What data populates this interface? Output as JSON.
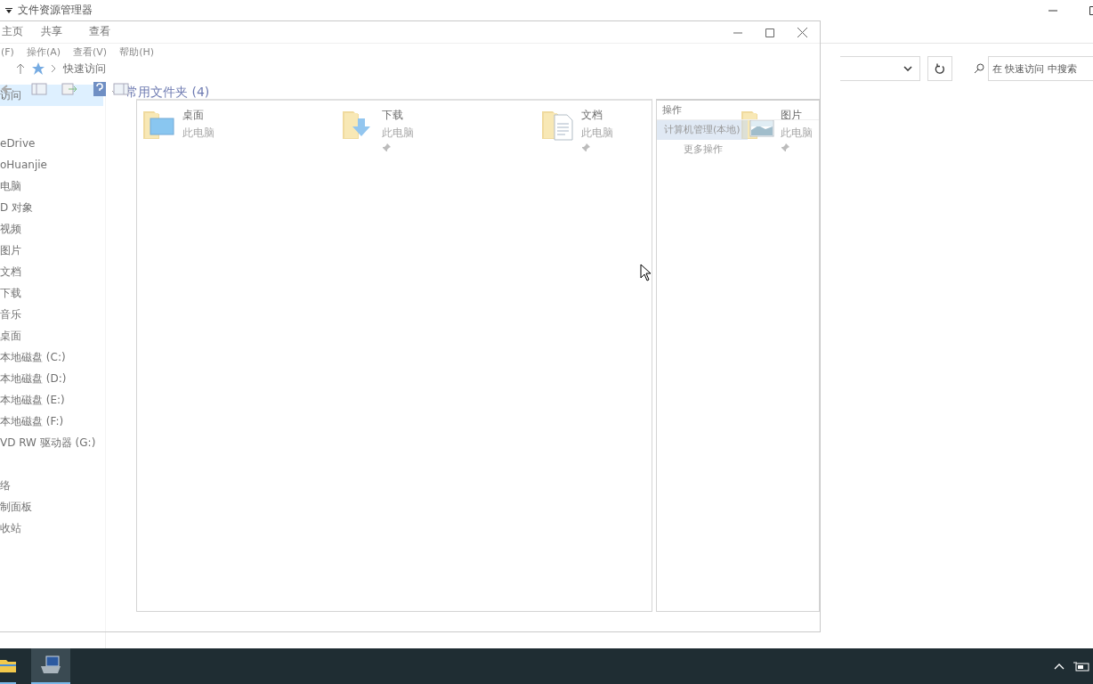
{
  "explorer": {
    "title": "文件资源管理器",
    "ribbon_tabs": [
      {
        "label": "主页",
        "selected": false
      },
      {
        "label": "共享",
        "selected": false
      },
      {
        "label": "查看",
        "selected": false
      }
    ],
    "address": {
      "location": "快速访问"
    },
    "search": {
      "placeholder": "在 快速访问 中搜索"
    },
    "nav_groups": [
      [
        {
          "label": "访问",
          "selected": true
        }
      ],
      [
        {
          "label": "eDrive",
          "selected": false
        },
        {
          "label": "oHuanjie",
          "selected": false
        },
        {
          "label": "电脑",
          "selected": false
        },
        {
          "label": "D 对象",
          "selected": false
        },
        {
          "label": "视频",
          "selected": false
        },
        {
          "label": "图片",
          "selected": false
        },
        {
          "label": "文档",
          "selected": false
        },
        {
          "label": "下载",
          "selected": false
        },
        {
          "label": "音乐",
          "selected": false
        },
        {
          "label": "桌面",
          "selected": false
        },
        {
          "label": "本地磁盘 (C:)",
          "selected": false
        },
        {
          "label": "本地磁盘 (D:)",
          "selected": false
        },
        {
          "label": "本地磁盘 (E:)",
          "selected": false
        },
        {
          "label": "本地磁盘 (F:)",
          "selected": false
        },
        {
          "label": "VD RW 驱动器 (G:)",
          "selected": false
        }
      ],
      [
        {
          "label": "络",
          "selected": false
        },
        {
          "label": "制面板",
          "selected": false
        },
        {
          "label": "收站",
          "selected": false
        }
      ]
    ],
    "group": {
      "title": "常用文件夹 (4)",
      "expanded": true
    },
    "folders": [
      {
        "name": "桌面",
        "location": "此电脑",
        "pinned": false,
        "kind": "desktop"
      },
      {
        "name": "下载",
        "location": "此电脑",
        "pinned": true,
        "kind": "downloads"
      },
      {
        "name": "文档",
        "location": "此电脑",
        "pinned": true,
        "kind": "documents"
      },
      {
        "name": "图片",
        "location": "此电脑",
        "pinned": true,
        "kind": "pictures"
      }
    ]
  },
  "management": {
    "menu": [
      "(F)",
      "操作(A)",
      "查看(V)",
      "帮助(H)"
    ],
    "actions": {
      "title": "操作",
      "items": [
        {
          "label": "计算机管理(本地)",
          "selected": true
        },
        {
          "label": "更多操作",
          "selected": false
        }
      ]
    }
  },
  "taskbar": {
    "apps": [
      {
        "kind": "explorer",
        "active": false
      },
      {
        "kind": "management",
        "active": true
      }
    ]
  }
}
